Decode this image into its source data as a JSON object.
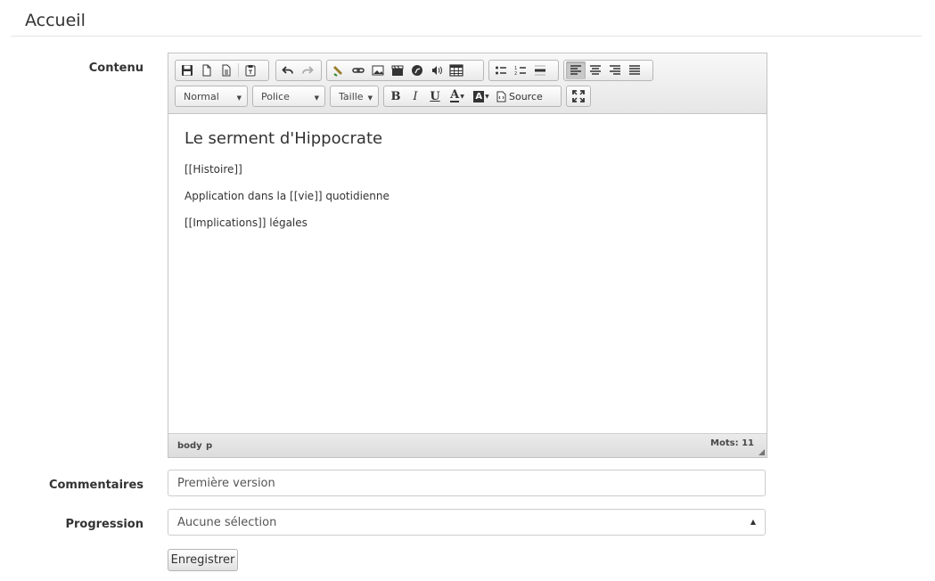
{
  "page": {
    "title": "Accueil"
  },
  "labels": {
    "content": "Contenu",
    "comments": "Commentaires",
    "progress": "Progression"
  },
  "editor": {
    "toolbar": {
      "format_combo": "Normal",
      "font_combo": "Police",
      "size_combo": "Taille",
      "bold": "B",
      "italic": "I",
      "underline": "U",
      "text_color": "A",
      "bg_color": "A",
      "source_label": "Source"
    },
    "content": {
      "heading": "Le serment d'Hippocrate",
      "paragraphs": [
        "[[Histoire]]",
        "Application dans la [[vie]] quotidienne",
        "[[Implications]] légales"
      ]
    },
    "status": {
      "path": [
        "body",
        "p"
      ],
      "word_count": "Mots: 11"
    }
  },
  "comments": {
    "value": "Première version"
  },
  "progress": {
    "selected": "Aucune sélection"
  },
  "actions": {
    "save_label": "Enregistrer"
  }
}
